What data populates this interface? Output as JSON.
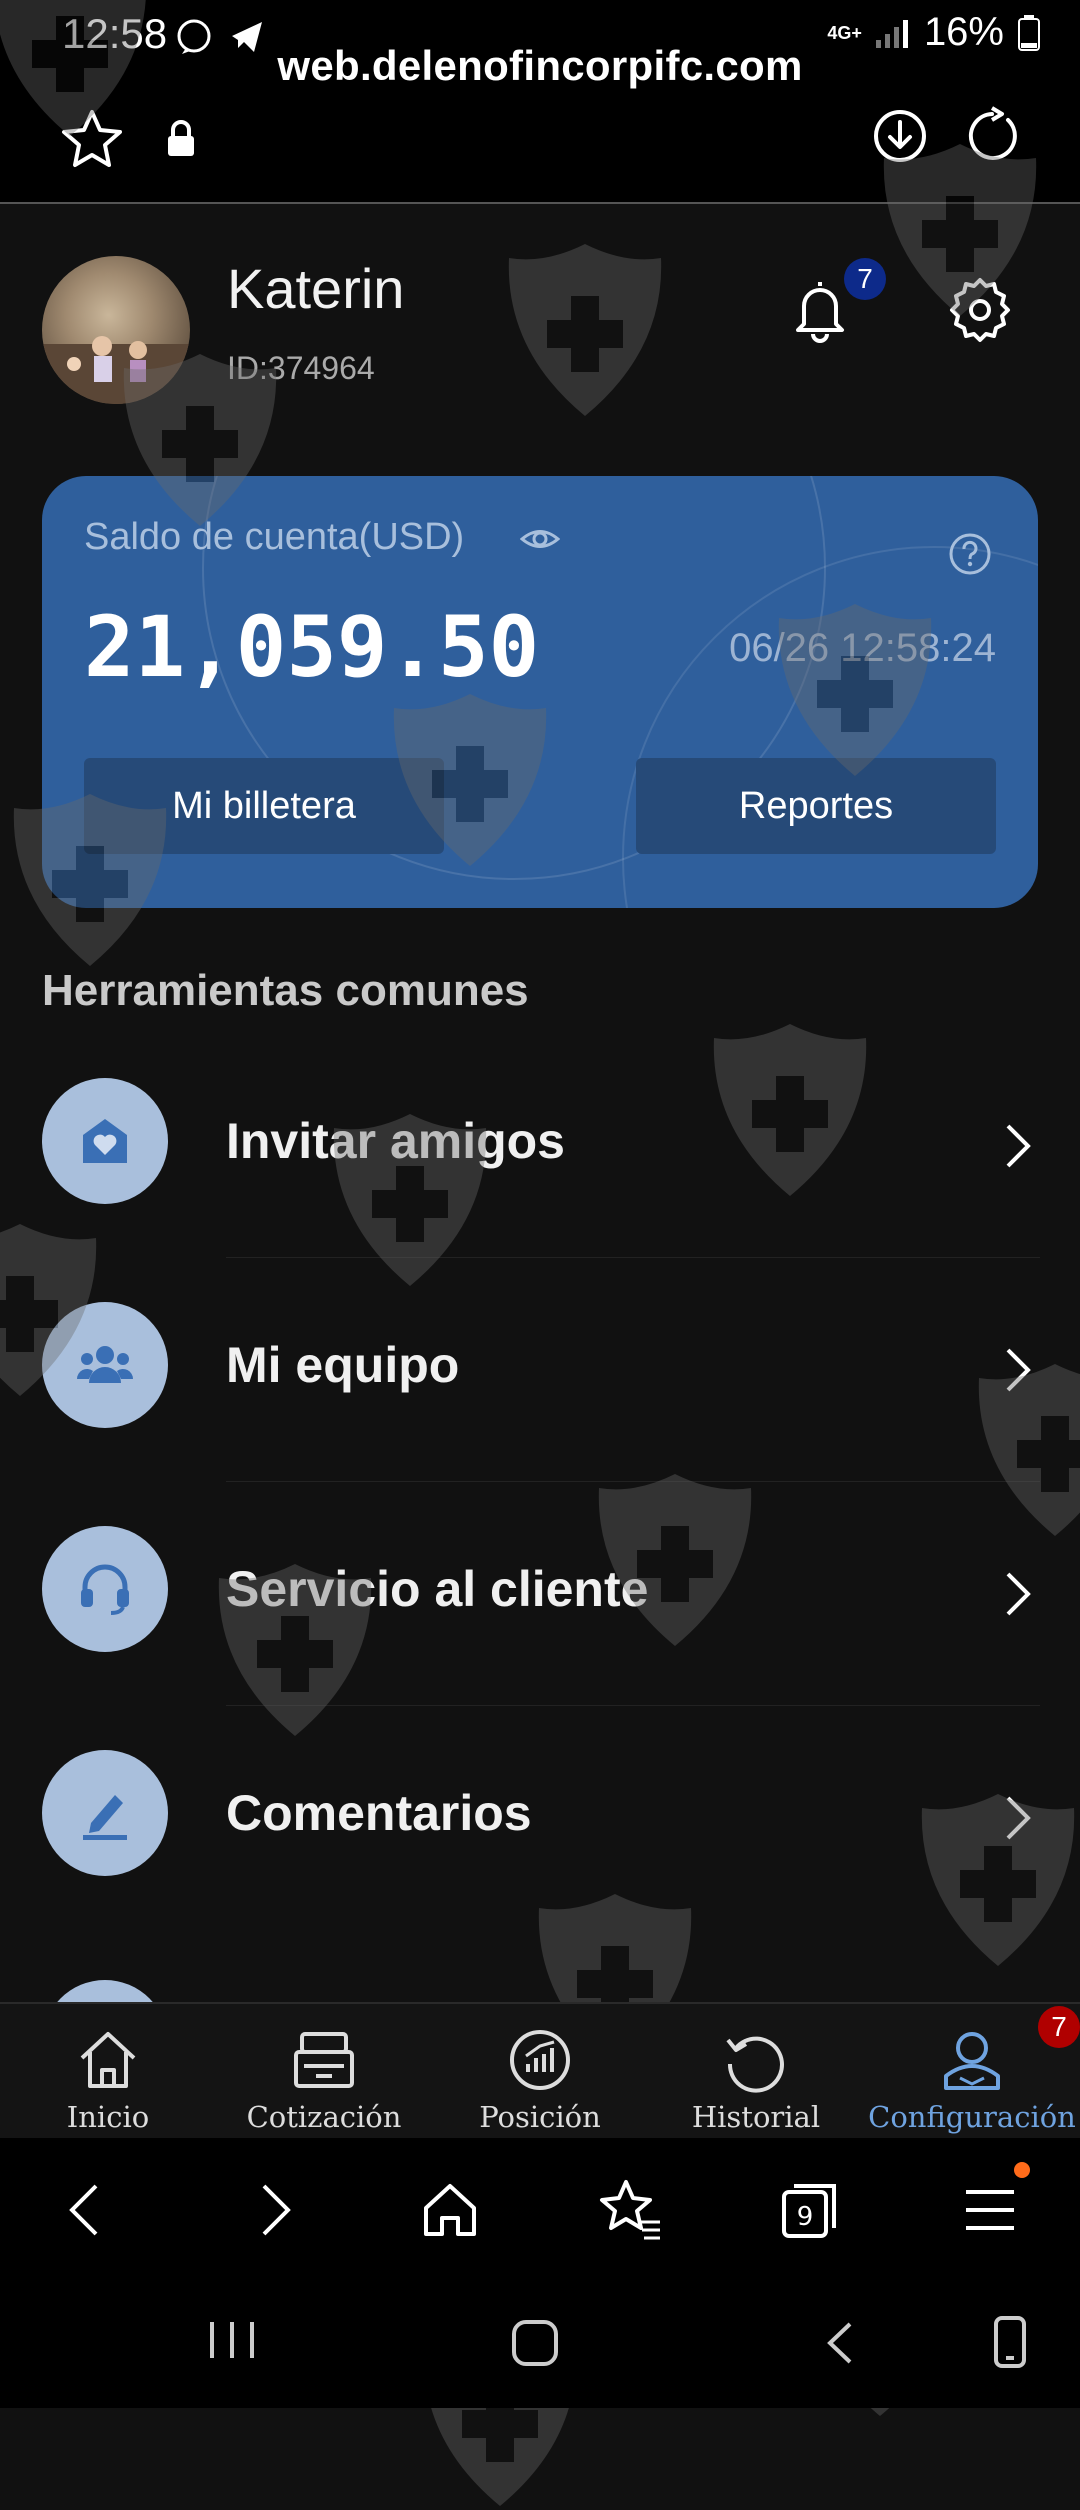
{
  "status": {
    "time": "12:58",
    "network": "4G+",
    "battery": "16%"
  },
  "browser": {
    "url": "web.delenofincorpifc.com"
  },
  "profile": {
    "name": "Katerin",
    "id": "ID:374964",
    "notification_count": "7"
  },
  "card": {
    "label": "Saldo de cuenta(USD)",
    "balance": "21,059.50",
    "timestamp": "06/26 12:58:24",
    "wallet_label": "Mi billetera",
    "reports_label": "Reportes"
  },
  "tools": {
    "title": "Herramientas comunes",
    "items": [
      {
        "label": "Invitar amigos",
        "icon": "invite-mail-icon"
      },
      {
        "label": "Mi equipo",
        "icon": "team-icon"
      },
      {
        "label": "Servicio al cliente",
        "icon": "headset-icon"
      },
      {
        "label": "Comentarios",
        "icon": "pen-icon"
      }
    ]
  },
  "nav": {
    "items": [
      {
        "label": "Inicio",
        "icon": "home-icon"
      },
      {
        "label": "Cotización",
        "icon": "quote-icon"
      },
      {
        "label": "Posición",
        "icon": "position-icon"
      },
      {
        "label": "Historial",
        "icon": "history-icon"
      },
      {
        "label": "Configuración",
        "icon": "profile-icon"
      }
    ],
    "badge": "7",
    "active_color": "#6fa3e0"
  },
  "colors": {
    "card": "#2f5f9c",
    "card_button": "#264a78",
    "background": "#111111",
    "icon_circle": "#a9bfdc"
  }
}
